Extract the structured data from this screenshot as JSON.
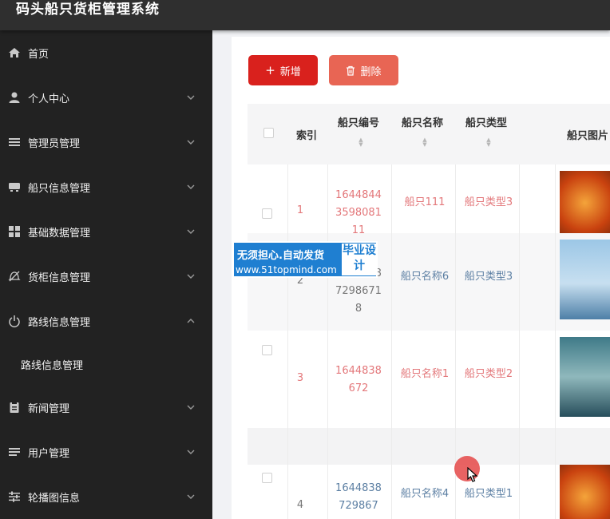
{
  "app": {
    "title": "码头船只货柜管理系统"
  },
  "sidebar": {
    "items": [
      {
        "label": "首页",
        "icon": "home-icon"
      },
      {
        "label": "个人中心",
        "icon": "user-icon"
      },
      {
        "label": "管理员管理",
        "icon": "list-icon"
      },
      {
        "label": "船只信息管理",
        "icon": "ship-icon"
      },
      {
        "label": "基础数据管理",
        "icon": "grid-icon"
      },
      {
        "label": "货柜信息管理",
        "icon": "container-icon"
      },
      {
        "label": "路线信息管理",
        "icon": "power-icon"
      },
      {
        "label": "路线信息管理",
        "icon": ""
      },
      {
        "label": "新闻管理",
        "icon": "clipboard-icon"
      },
      {
        "label": "用户管理",
        "icon": "users-list-icon"
      },
      {
        "label": "轮播图信息",
        "icon": "sliders-icon"
      }
    ]
  },
  "toolbar": {
    "add_label": "新增",
    "delete_label": "删除"
  },
  "table": {
    "columns": [
      "索引",
      "船只编号",
      "船只名称",
      "船只类型",
      "船只图片"
    ],
    "rows": [
      {
        "index": "1",
        "code": "1644844359808111",
        "name": "船只111",
        "type": "船只类型3"
      },
      {
        "index": "2",
        "code": "164483872986718",
        "name": "船只名称6",
        "type": "船只类型3"
      },
      {
        "index": "3",
        "code": "1644838672",
        "name": "船只名称1",
        "type": "船只类型2"
      },
      {
        "index": "4",
        "code": "1644838729867",
        "name": "船只名称4",
        "type": "船只类型1"
      }
    ]
  },
  "watermark": {
    "line1": "无须担心.自动发货",
    "line2": "www.51topmind.com",
    "badge": "毕业设计"
  },
  "colors": {
    "primary": "#d9211d",
    "danger_light": "#e86554",
    "sidebar": "#222222",
    "topbar": "#2f2f2f"
  }
}
